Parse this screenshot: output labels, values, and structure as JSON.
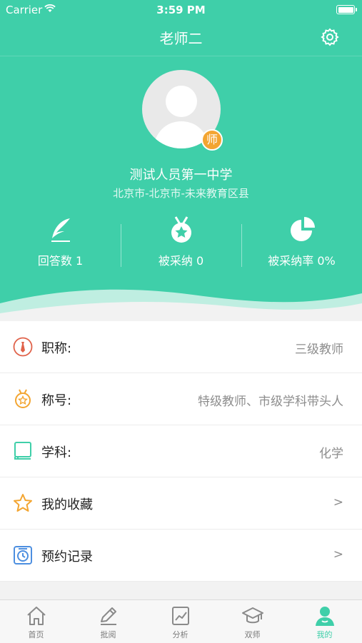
{
  "status_bar": {
    "carrier": "Carrier",
    "time": "3:59 PM"
  },
  "nav": {
    "title": "老师二",
    "settings_icon": "gear-icon"
  },
  "profile": {
    "badge": "师",
    "school": "测试人员第一中学",
    "location": "北京市-北京市-未来教育区县"
  },
  "stats": [
    {
      "label": "回答数 1",
      "icon": "quill-icon"
    },
    {
      "label": "被采纳 0",
      "icon": "medal-icon"
    },
    {
      "label": "被采纳率 0%",
      "icon": "pie-chart-icon"
    }
  ],
  "list": {
    "title_row": {
      "label": "职称:",
      "value": "三级教师",
      "icon": "tie-icon"
    },
    "honor_row": {
      "label": "称号:",
      "value": "特级教师、市级学科带头人",
      "icon": "medal-icon"
    },
    "subject_row": {
      "label": "学科:",
      "value": "化学",
      "icon": "book-icon"
    },
    "favorites_row": {
      "label": "我的收藏",
      "arrow": ">",
      "icon": "star-icon"
    },
    "booking_row": {
      "label": "预约记录",
      "arrow": ">",
      "icon": "clock-icon"
    }
  },
  "tabs": [
    {
      "label": "首页",
      "icon": "home-icon"
    },
    {
      "label": "批阅",
      "icon": "pen-icon"
    },
    {
      "label": "分析",
      "icon": "chart-icon"
    },
    {
      "label": "双师",
      "icon": "graduation-cap-icon"
    },
    {
      "label": "我的",
      "icon": "user-icon",
      "active": true
    }
  ],
  "colors": {
    "accent": "#3fcfa9",
    "badge": "#f3a531"
  }
}
